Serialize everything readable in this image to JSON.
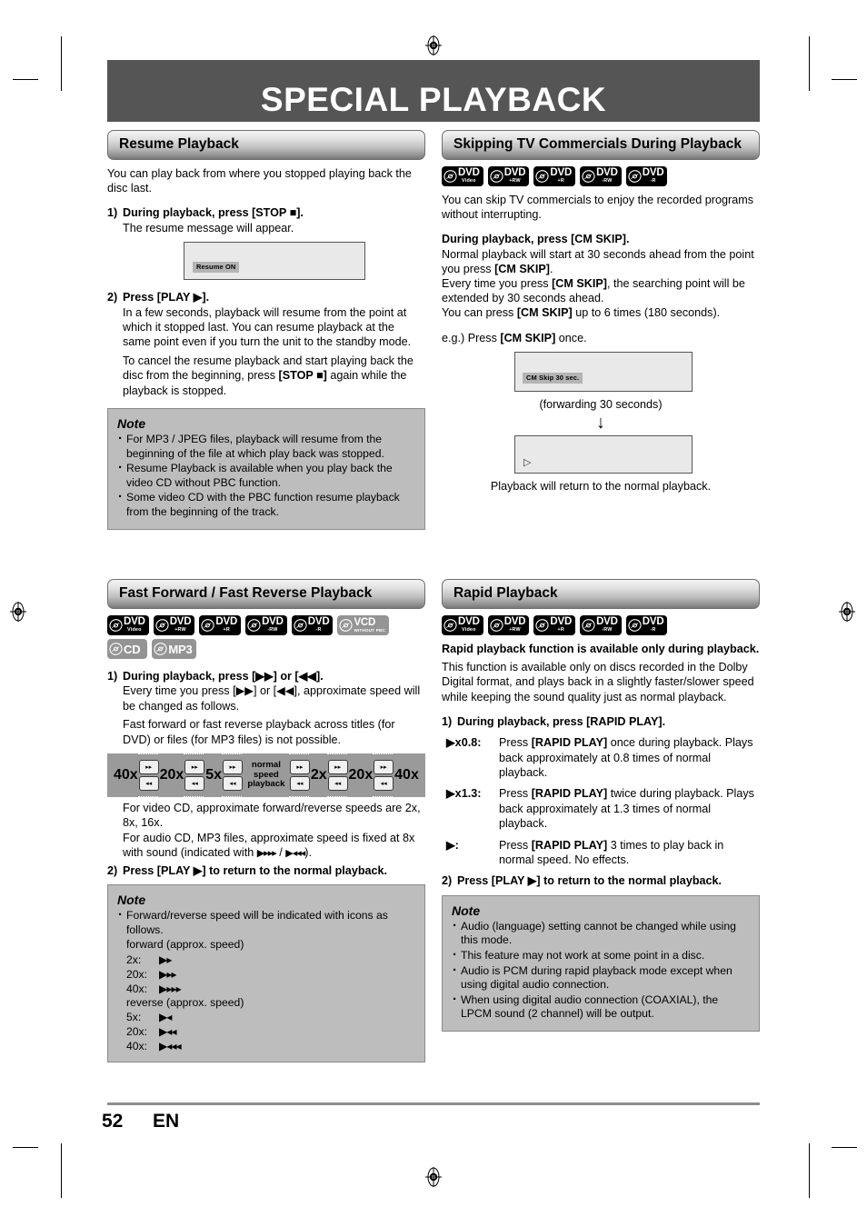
{
  "page": {
    "title": "SPECIAL PLAYBACK",
    "number": "52",
    "language": "EN"
  },
  "left": {
    "resume": {
      "heading": "Resume Playback",
      "intro": "You can play back from where you stopped playing back the disc last.",
      "step1_num": "1)",
      "step1": "During playback, press [STOP ■].",
      "step1_sub": "The resume message will appear.",
      "screen_osd": "Resume ON",
      "step2_num": "2)",
      "step2": "Press [PLAY ▶].",
      "step2_p1": "In a few seconds, playback will resume from the point at which it stopped last. You can resume playback at the same point even if you turn the unit to the standby mode.",
      "step2_p2_a": "To cancel the resume playback and start playing back the disc from the beginning, press ",
      "step2_p2_b": "[STOP ■]",
      "step2_p2_c": " again while the playback is stopped.",
      "note_heading": "Note",
      "notes": [
        "For MP3 / JPEG files, playback will resume from the beginning of the file at which play back was stopped.",
        "Resume Playback is available when you play back the video CD without PBC function.",
        "Some video CD with the PBC function resume playback from the beginning of the track."
      ]
    },
    "fastforward": {
      "heading": "Fast Forward / Fast Reverse Playback",
      "badges": [
        {
          "main": "DVD",
          "sub": "Video",
          "style": "dark"
        },
        {
          "main": "DVD",
          "sub": "+RW",
          "style": "dark"
        },
        {
          "main": "DVD",
          "sub": "+R",
          "style": "dark"
        },
        {
          "main": "DVD",
          "sub": "-RW",
          "style": "dark"
        },
        {
          "main": "DVD",
          "sub": "-R",
          "style": "dark"
        },
        {
          "main": "VCD",
          "sub": "WITHOUT PBC",
          "style": "grey"
        },
        {
          "main": "CD",
          "sub": "",
          "style": "grey"
        },
        {
          "main": "MP3",
          "sub": "",
          "style": "grey"
        }
      ],
      "step1_num": "1)",
      "step1": "During playback, press [▶▶] or [◀◀].",
      "step1_p1": "Every time you press [▶▶] or [◀◀], approximate speed will be changed as follows.",
      "step1_p2": "Fast forward or fast reverse playback across titles (for DVD) or files (for MP3 files) is not possible.",
      "speed_diagram": {
        "left_speeds": [
          "40x",
          "20x",
          "5x"
        ],
        "normal_label": "normal speed playback",
        "right_speeds": [
          "2x",
          "20x",
          "40x"
        ],
        "forward_glyph": "▸▸",
        "reverse_glyph": "◂◂"
      },
      "after_p1": "For video CD, approximate forward/reverse speeds are 2x, 8x, 16x.",
      "after_p2_a": "For audio CD, MP3 files, approximate speed is fixed at 8x with sound (indicated with ",
      "after_p2_b": " / ",
      "after_p2_c": ").",
      "step2_num": "2)",
      "step2": "Press [PLAY ▶] to return to the normal playback.",
      "note_heading": "Note",
      "note_bullet": "Forward/reverse speed will be indicated with icons as follows.",
      "note_fwd_label": "forward (approx. speed)",
      "note_fwd_rows": [
        {
          "label": "2x:",
          "arrows": 1
        },
        {
          "label": "20x:",
          "arrows": 2
        },
        {
          "label": "40x:",
          "arrows": 3
        }
      ],
      "note_rev_label": "reverse (approx. speed)",
      "note_rev_rows": [
        {
          "label": "5x:",
          "arrows": 1
        },
        {
          "label": "20x:",
          "arrows": 2
        },
        {
          "label": "40x:",
          "arrows": 3
        }
      ]
    }
  },
  "right": {
    "cmskip": {
      "heading": "Skipping TV Commercials During Playback",
      "badges": [
        {
          "main": "DVD",
          "sub": "Video",
          "style": "dark"
        },
        {
          "main": "DVD",
          "sub": "+RW",
          "style": "dark"
        },
        {
          "main": "DVD",
          "sub": "+R",
          "style": "dark"
        },
        {
          "main": "DVD",
          "sub": "-RW",
          "style": "dark"
        },
        {
          "main": "DVD",
          "sub": "-R",
          "style": "dark"
        }
      ],
      "intro": "You can skip TV commercials to enjoy the recorded programs without interrupting.",
      "bold_line": "During playback, press [CM SKIP].",
      "p1_a": "Normal playback will start at 30 seconds ahead from the point you press ",
      "p1_b": "[CM SKIP]",
      "p1_c": ".",
      "p2_a": "Every time you press ",
      "p2_b": "[CM SKIP]",
      "p2_c": ", the searching point will be extended by 30 seconds ahead.",
      "p3_a": "You can press ",
      "p3_b": "[CM SKIP]",
      "p3_c": " up to 6 times (180 seconds).",
      "eg_a": "e.g.) Press ",
      "eg_b": "[CM SKIP]",
      "eg_c": " once.",
      "screen1_osd": "CM Skip 30 sec.",
      "caption1": "(forwarding 30 seconds)",
      "arrow": "↓",
      "screen2_osd": "▷",
      "caption2": "Playback will return to the normal playback."
    },
    "rapid": {
      "heading": "Rapid Playback",
      "badges": [
        {
          "main": "DVD",
          "sub": "Video",
          "style": "dark"
        },
        {
          "main": "DVD",
          "sub": "+RW",
          "style": "dark"
        },
        {
          "main": "DVD",
          "sub": "+R",
          "style": "dark"
        },
        {
          "main": "DVD",
          "sub": "-RW",
          "style": "dark"
        },
        {
          "main": "DVD",
          "sub": "-R",
          "style": "dark"
        }
      ],
      "bold_line": "Rapid playback function is available only during playback.",
      "intro": "This function is available only on discs recorded in the Dolby Digital format, and plays back in a slightly faster/slower speed while keeping the sound quality just as normal playback.",
      "step1_num": "1)",
      "step1": "During playback, press [RAPID PLAY].",
      "modes": [
        {
          "label": "▶x0.8:",
          "text_a": "Press ",
          "text_b": "[RAPID PLAY]",
          "text_c": " once during playback. Plays back approximately at 0.8 times of normal playback."
        },
        {
          "label": "▶x1.3:",
          "text_a": "Press ",
          "text_b": "[RAPID PLAY]",
          "text_c": " twice during playback. Plays back approximately at 1.3 times of normal playback."
        },
        {
          "label": "▶:",
          "text_a": "Press ",
          "text_b": "[RAPID PLAY]",
          "text_c": " 3 times to play back in normal speed. No effects."
        }
      ],
      "step2_num": "2)",
      "step2": "Press [PLAY ▶] to return to the normal playback.",
      "note_heading": "Note",
      "notes": [
        "Audio (language) setting cannot be changed while using this mode.",
        "This feature may not work at some point in a disc.",
        "Audio is PCM during rapid playback mode except when using digital audio connection.",
        "When using digital audio connection (COAXIAL), the LPCM sound (2 channel) will be output."
      ]
    }
  },
  "colors": {
    "banner_bg": "#555555",
    "note_bg": "#bdbdbd",
    "screen_bg": "#e9e9e9",
    "osd_bg": "#b4b4b4",
    "speed_bg": "#9a9a9a",
    "badge_dark": "#000000",
    "badge_grey": "#949494"
  }
}
